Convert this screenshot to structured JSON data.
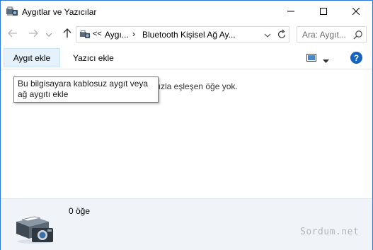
{
  "window": {
    "title": "Aygıtlar ve Yazıcılar",
    "icon": "devices-and-printers-icon"
  },
  "titlebar_buttons": {
    "minimize": "minimize-icon",
    "maximize": "maximize-icon",
    "close": "close-icon"
  },
  "address": {
    "overflow": "<<",
    "crumb1": "Aygı...",
    "separator": "›",
    "crumb2": "Bluetooth Kişisel Ağ Ay..."
  },
  "search": {
    "placeholder": "Ara: Aygıt..."
  },
  "commands": {
    "add_device": "Aygıt ekle",
    "add_printer": "Yazıcı ekle",
    "help": "?"
  },
  "content": {
    "empty_message": "nızla eşleşen öğe yok.",
    "tooltip": "Bu bilgisayara kablosuz aygıt veya ağ aygıtı ekle"
  },
  "details": {
    "item_count": "0 öğe",
    "watermark": "Sordum.net"
  },
  "colors": {
    "accent": "#2b79d6",
    "selected_button_bg": "#e5f1fb",
    "details_bg": "#f0f4f9",
    "help_blue": "#1565c0"
  }
}
